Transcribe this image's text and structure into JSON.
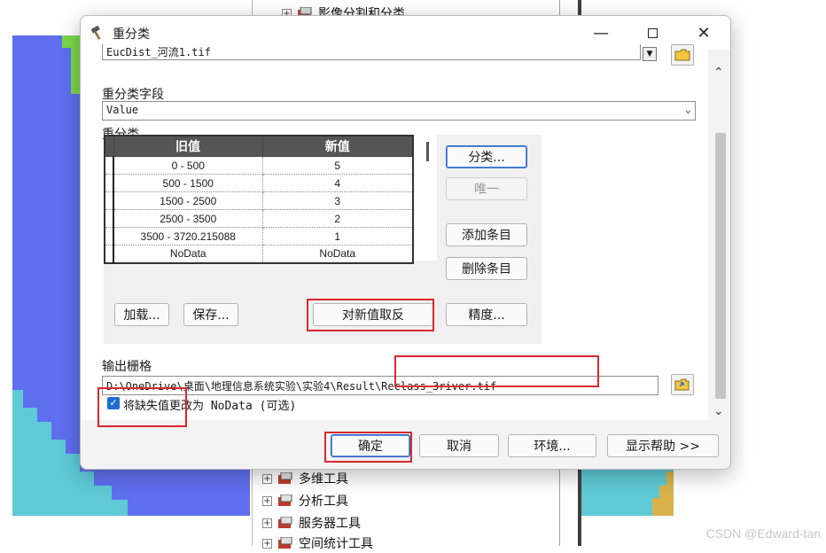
{
  "background": {
    "tree_top_item": "影像分割和分类",
    "tree_items": [
      "多维工具",
      "分析工具",
      "服务器工具",
      "空间统计工具"
    ],
    "watermark": "CSDN @Edward-tan"
  },
  "dialog": {
    "title": "重分类",
    "input_raster_value": "EucDist_河流1.tif",
    "reclass_field_label": "重分类字段",
    "reclass_field_value": "Value",
    "reclass_label": "重分类",
    "table": {
      "headers": [
        "旧值",
        "新值"
      ],
      "rows": [
        [
          "0 - 500",
          "5"
        ],
        [
          "500 - 1500",
          "4"
        ],
        [
          "1500 - 2500",
          "3"
        ],
        [
          "2500 - 3500",
          "2"
        ],
        [
          "3500 - 3720.215088",
          "1"
        ],
        [
          "NoData",
          "NoData"
        ]
      ]
    },
    "buttons": {
      "classify": "分类...",
      "unique": "唯一",
      "add_entry": "添加条目",
      "delete_entry": "删除条目",
      "load": "加载...",
      "save": "保存...",
      "reverse": "对新值取反",
      "precision": "精度..."
    },
    "output_label": "输出栅格",
    "output_value": "D:\\OneDrive\\桌面\\地理信息系统实验\\实验4\\Result\\Reclass_3river.tif",
    "nodata_checkbox_label": "将缺失值更改为 NoData (可选)",
    "nodata_checked": true,
    "footer": {
      "ok": "确定",
      "cancel": "取消",
      "environments": "环境...",
      "show_help": "显示帮助 >>"
    }
  },
  "colors": {
    "accent": "#1f6fd0",
    "highlight": "#d9282f"
  }
}
